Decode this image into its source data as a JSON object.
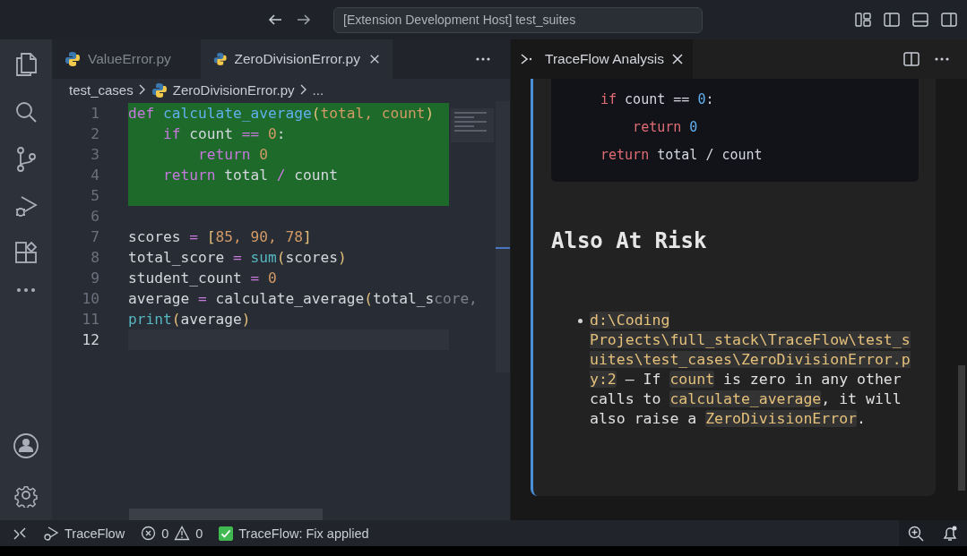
{
  "title_bar": {
    "command_center": "[Extension Development Host] test_suites"
  },
  "editor_tabs": [
    {
      "label": "ValueError.py",
      "selected": false
    },
    {
      "label": "ZeroDivisionError.py",
      "selected": true
    }
  ],
  "breadcrumbs": [
    "test_cases",
    "ZeroDivisionError.py",
    "..."
  ],
  "code_lines": [
    {
      "number": "1",
      "highlighted": true,
      "current": false,
      "tokens": [
        {
          "text": "def ",
          "kind": "keyword"
        },
        {
          "text": "calculate_average",
          "kind": "function"
        },
        {
          "text": "(",
          "kind": "bracket"
        },
        {
          "text": "total, count",
          "kind": "param"
        },
        {
          "text": ")",
          "kind": "bracket"
        }
      ]
    },
    {
      "number": "2",
      "highlighted": true,
      "current": false,
      "tokens": [
        {
          "text": "    if ",
          "kind": "keyword"
        },
        {
          "text": "count ",
          "kind": "plain"
        },
        {
          "text": "== ",
          "kind": "operator"
        },
        {
          "text": "0",
          "kind": "number"
        },
        {
          "text": ":",
          "kind": "plain"
        }
      ]
    },
    {
      "number": "3",
      "highlighted": true,
      "current": false,
      "tokens": [
        {
          "text": "        return ",
          "kind": "keyword"
        },
        {
          "text": "0",
          "kind": "number"
        }
      ]
    },
    {
      "number": "4",
      "highlighted": true,
      "current": false,
      "tokens": [
        {
          "text": "    return ",
          "kind": "keyword"
        },
        {
          "text": "total ",
          "kind": "plain"
        },
        {
          "text": "/ ",
          "kind": "operator"
        },
        {
          "text": "count",
          "kind": "plain"
        }
      ]
    },
    {
      "number": "5",
      "highlighted": true,
      "current": false
    },
    {
      "number": "6",
      "highlighted": false,
      "current": false
    },
    {
      "number": "7",
      "highlighted": false,
      "current": false,
      "tokens": [
        {
          "text": "scores ",
          "kind": "plain"
        },
        {
          "text": "= ",
          "kind": "operator"
        },
        {
          "text": "[",
          "kind": "bracket"
        },
        {
          "text": "85, 90, 78",
          "kind": "number"
        },
        {
          "text": "]",
          "kind": "bracket"
        }
      ]
    },
    {
      "number": "8",
      "highlighted": false,
      "current": false,
      "tokens": [
        {
          "text": "total_score ",
          "kind": "plain"
        },
        {
          "text": "= ",
          "kind": "operator"
        },
        {
          "text": "sum",
          "kind": "builtin"
        },
        {
          "text": "(",
          "kind": "bracket"
        },
        {
          "text": "scores",
          "kind": "plain"
        },
        {
          "text": ")",
          "kind": "bracket"
        }
      ]
    },
    {
      "number": "9",
      "highlighted": false,
      "current": false,
      "tokens": [
        {
          "text": "student_count ",
          "kind": "plain"
        },
        {
          "text": "= ",
          "kind": "operator"
        },
        {
          "text": "0",
          "kind": "number"
        }
      ]
    },
    {
      "number": "10",
      "highlighted": false,
      "current": false,
      "tokens": [
        {
          "text": "average ",
          "kind": "plain"
        },
        {
          "text": "= ",
          "kind": "operator"
        },
        {
          "text": "calculate_average",
          "kind": "plain"
        },
        {
          "text": "(",
          "kind": "bracket"
        },
        {
          "text": "total_s",
          "kind": "plain"
        },
        {
          "text": "core,",
          "kind": "faded"
        }
      ]
    },
    {
      "number": "11",
      "highlighted": false,
      "current": false,
      "tokens": [
        {
          "text": "print",
          "kind": "builtin"
        },
        {
          "text": "(",
          "kind": "bracket"
        },
        {
          "text": "average",
          "kind": "plain"
        },
        {
          "text": ")",
          "kind": "bracket"
        }
      ]
    },
    {
      "number": "12",
      "highlighted": false,
      "current": true
    }
  ],
  "panel": {
    "tab": "TraceFlow Analysis",
    "code_block": [
      [
        {
          "text": "if ",
          "kind": "keyword"
        },
        {
          "text": "count == ",
          "kind": "plain"
        },
        {
          "text": "0",
          "kind": "number"
        },
        {
          "text": ":",
          "kind": "plain"
        }
      ],
      [
        {
          "text": "    return ",
          "kind": "keyword"
        },
        {
          "text": "0",
          "kind": "number"
        }
      ],
      [
        {
          "text": "return ",
          "kind": "keyword"
        },
        {
          "text": "total / count",
          "kind": "plain"
        }
      ]
    ],
    "heading": "Also At Risk",
    "bullet": [
      {
        "text": "d:\\Coding Projects\\full_stack\\TraceFlow\\test_suites\\test_cases\\ZeroDivisionError.py:2",
        "kind": "code"
      },
      {
        "text": " — If ",
        "kind": "text"
      },
      {
        "text": "count",
        "kind": "code"
      },
      {
        "text": " is zero in any other calls to ",
        "kind": "text"
      },
      {
        "text": "calculate_average",
        "kind": "code"
      },
      {
        "text": ", it will also raise a ",
        "kind": "text"
      },
      {
        "text": "ZeroDivisionError",
        "kind": "code"
      },
      {
        "text": ".",
        "kind": "text"
      }
    ]
  },
  "status_bar": {
    "debug_item": "TraceFlow",
    "errors": "0",
    "warnings": "0",
    "message": "TraceFlow: Fix applied"
  }
}
